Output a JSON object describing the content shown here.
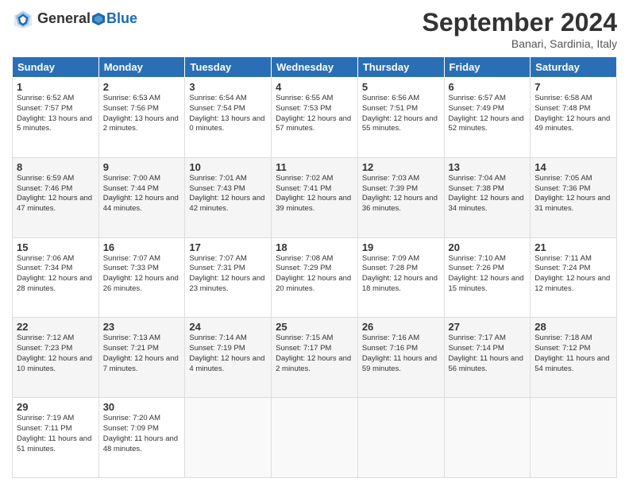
{
  "header": {
    "logo_line1": "General",
    "logo_line2": "Blue",
    "month_title": "September 2024",
    "subtitle": "Banari, Sardinia, Italy"
  },
  "days_of_week": [
    "Sunday",
    "Monday",
    "Tuesday",
    "Wednesday",
    "Thursday",
    "Friday",
    "Saturday"
  ],
  "weeks": [
    [
      {
        "day": "1",
        "sunrise": "6:52 AM",
        "sunset": "7:57 PM",
        "daylight": "13 hours and 5 minutes."
      },
      {
        "day": "2",
        "sunrise": "6:53 AM",
        "sunset": "7:56 PM",
        "daylight": "13 hours and 2 minutes."
      },
      {
        "day": "3",
        "sunrise": "6:54 AM",
        "sunset": "7:54 PM",
        "daylight": "13 hours and 0 minutes."
      },
      {
        "day": "4",
        "sunrise": "6:55 AM",
        "sunset": "7:53 PM",
        "daylight": "12 hours and 57 minutes."
      },
      {
        "day": "5",
        "sunrise": "6:56 AM",
        "sunset": "7:51 PM",
        "daylight": "12 hours and 55 minutes."
      },
      {
        "day": "6",
        "sunrise": "6:57 AM",
        "sunset": "7:49 PM",
        "daylight": "12 hours and 52 minutes."
      },
      {
        "day": "7",
        "sunrise": "6:58 AM",
        "sunset": "7:48 PM",
        "daylight": "12 hours and 49 minutes."
      }
    ],
    [
      {
        "day": "8",
        "sunrise": "6:59 AM",
        "sunset": "7:46 PM",
        "daylight": "12 hours and 47 minutes."
      },
      {
        "day": "9",
        "sunrise": "7:00 AM",
        "sunset": "7:44 PM",
        "daylight": "12 hours and 44 minutes."
      },
      {
        "day": "10",
        "sunrise": "7:01 AM",
        "sunset": "7:43 PM",
        "daylight": "12 hours and 42 minutes."
      },
      {
        "day": "11",
        "sunrise": "7:02 AM",
        "sunset": "7:41 PM",
        "daylight": "12 hours and 39 minutes."
      },
      {
        "day": "12",
        "sunrise": "7:03 AM",
        "sunset": "7:39 PM",
        "daylight": "12 hours and 36 minutes."
      },
      {
        "day": "13",
        "sunrise": "7:04 AM",
        "sunset": "7:38 PM",
        "daylight": "12 hours and 34 minutes."
      },
      {
        "day": "14",
        "sunrise": "7:05 AM",
        "sunset": "7:36 PM",
        "daylight": "12 hours and 31 minutes."
      }
    ],
    [
      {
        "day": "15",
        "sunrise": "7:06 AM",
        "sunset": "7:34 PM",
        "daylight": "12 hours and 28 minutes."
      },
      {
        "day": "16",
        "sunrise": "7:07 AM",
        "sunset": "7:33 PM",
        "daylight": "12 hours and 26 minutes."
      },
      {
        "day": "17",
        "sunrise": "7:07 AM",
        "sunset": "7:31 PM",
        "daylight": "12 hours and 23 minutes."
      },
      {
        "day": "18",
        "sunrise": "7:08 AM",
        "sunset": "7:29 PM",
        "daylight": "12 hours and 20 minutes."
      },
      {
        "day": "19",
        "sunrise": "7:09 AM",
        "sunset": "7:28 PM",
        "daylight": "12 hours and 18 minutes."
      },
      {
        "day": "20",
        "sunrise": "7:10 AM",
        "sunset": "7:26 PM",
        "daylight": "12 hours and 15 minutes."
      },
      {
        "day": "21",
        "sunrise": "7:11 AM",
        "sunset": "7:24 PM",
        "daylight": "12 hours and 12 minutes."
      }
    ],
    [
      {
        "day": "22",
        "sunrise": "7:12 AM",
        "sunset": "7:23 PM",
        "daylight": "12 hours and 10 minutes."
      },
      {
        "day": "23",
        "sunrise": "7:13 AM",
        "sunset": "7:21 PM",
        "daylight": "12 hours and 7 minutes."
      },
      {
        "day": "24",
        "sunrise": "7:14 AM",
        "sunset": "7:19 PM",
        "daylight": "12 hours and 4 minutes."
      },
      {
        "day": "25",
        "sunrise": "7:15 AM",
        "sunset": "7:17 PM",
        "daylight": "12 hours and 2 minutes."
      },
      {
        "day": "26",
        "sunrise": "7:16 AM",
        "sunset": "7:16 PM",
        "daylight": "11 hours and 59 minutes."
      },
      {
        "day": "27",
        "sunrise": "7:17 AM",
        "sunset": "7:14 PM",
        "daylight": "11 hours and 56 minutes."
      },
      {
        "day": "28",
        "sunrise": "7:18 AM",
        "sunset": "7:12 PM",
        "daylight": "11 hours and 54 minutes."
      }
    ],
    [
      {
        "day": "29",
        "sunrise": "7:19 AM",
        "sunset": "7:11 PM",
        "daylight": "11 hours and 51 minutes."
      },
      {
        "day": "30",
        "sunrise": "7:20 AM",
        "sunset": "7:09 PM",
        "daylight": "11 hours and 48 minutes."
      },
      null,
      null,
      null,
      null,
      null
    ]
  ]
}
